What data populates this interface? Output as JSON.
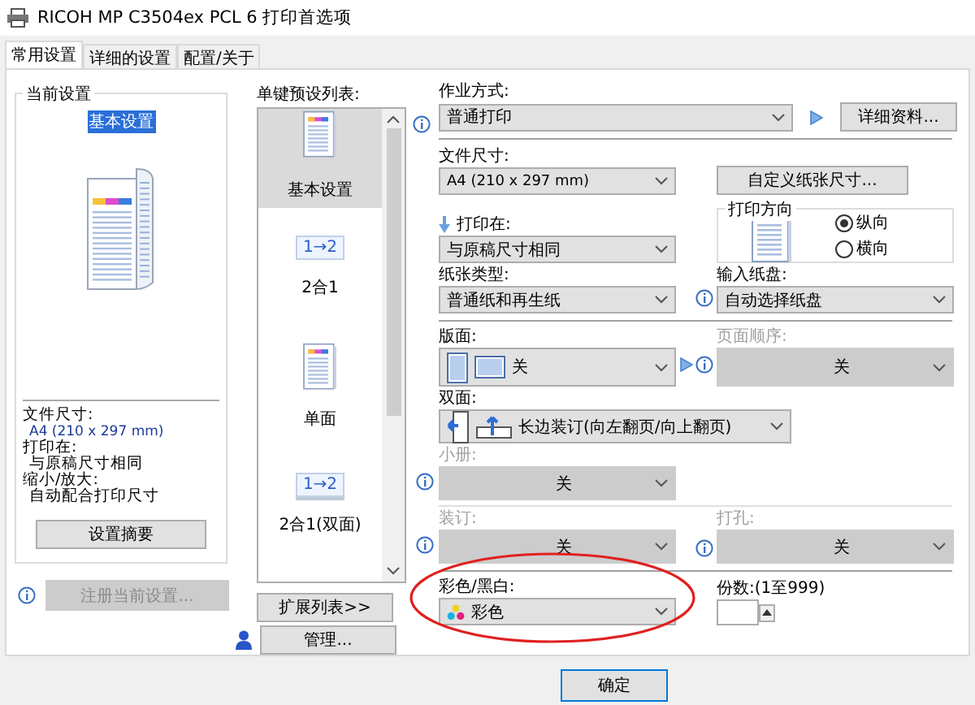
{
  "window": {
    "title": "RICOH MP C3504ex PCL 6 打印首选项"
  },
  "tabs": [
    {
      "label": "常用设置",
      "selected": true
    },
    {
      "label": "详细的设置",
      "selected": false
    },
    {
      "label": "配置/关于",
      "selected": false
    }
  ],
  "current_settings": {
    "title": "当前设置",
    "preset_name": "基本设置",
    "summary": [
      {
        "label": "文件尺寸:",
        "value": "A4 (210 x 297 mm)"
      },
      {
        "label": "打印在:",
        "value": "与原稿尺寸相同"
      },
      {
        "label": "缩小/放大:",
        "value": "自动配合打印尺寸"
      }
    ],
    "summary_button": "设置摘要",
    "register_button": {
      "label": "注册当前设置...",
      "disabled": true
    }
  },
  "presets": {
    "label": "单键预设列表:",
    "items": [
      {
        "label": "基本设置",
        "kind": "page",
        "selected": true
      },
      {
        "label": "2合1",
        "kind": "two_up",
        "icon_text": "1→2",
        "selected": false
      },
      {
        "label": "单面",
        "kind": "page",
        "selected": false
      },
      {
        "label": "2合1(双面)",
        "kind": "two_up_duplex",
        "icon_text": "1→2",
        "selected": false
      }
    ],
    "expand_button": "扩展列表>>",
    "manage_button": "管理..."
  },
  "job_mode": {
    "label": "作业方式:",
    "value": "普通打印",
    "details_button": "详细资料..."
  },
  "document_size": {
    "label": "文件尺寸:",
    "value": "A4 (210 x 297 mm)",
    "custom_button": "自定义纸张尺寸..."
  },
  "print_on": {
    "label": "打印在:",
    "value": "与原稿尺寸相同"
  },
  "orientation": {
    "title": "打印方向",
    "options": [
      {
        "label": "纵向",
        "selected": true
      },
      {
        "label": "横向",
        "selected": false
      }
    ]
  },
  "paper_type": {
    "label": "纸张类型:",
    "value": "普通纸和再生纸"
  },
  "input_tray": {
    "label": "输入纸盘:",
    "value": "自动选择纸盘"
  },
  "layout": {
    "label": "版面:",
    "value": "关",
    "disabled": false
  },
  "page_order": {
    "label": "页面顺序:",
    "value": "关",
    "disabled": true
  },
  "duplex": {
    "label": "双面:",
    "value": "长边装订(向左翻页/向上翻页)",
    "disabled": false
  },
  "booklet": {
    "label": "小册:",
    "value": "关",
    "disabled": true
  },
  "staple": {
    "label": "装订:",
    "value": "关",
    "disabled": true
  },
  "punch": {
    "label": "打孔:",
    "value": "关",
    "disabled": true
  },
  "color_mode": {
    "label": "彩色/黑白:",
    "value": "彩色",
    "disabled": false
  },
  "copies": {
    "label": "份数:(1至999)"
  },
  "buttons": [
    "确定"
  ]
}
